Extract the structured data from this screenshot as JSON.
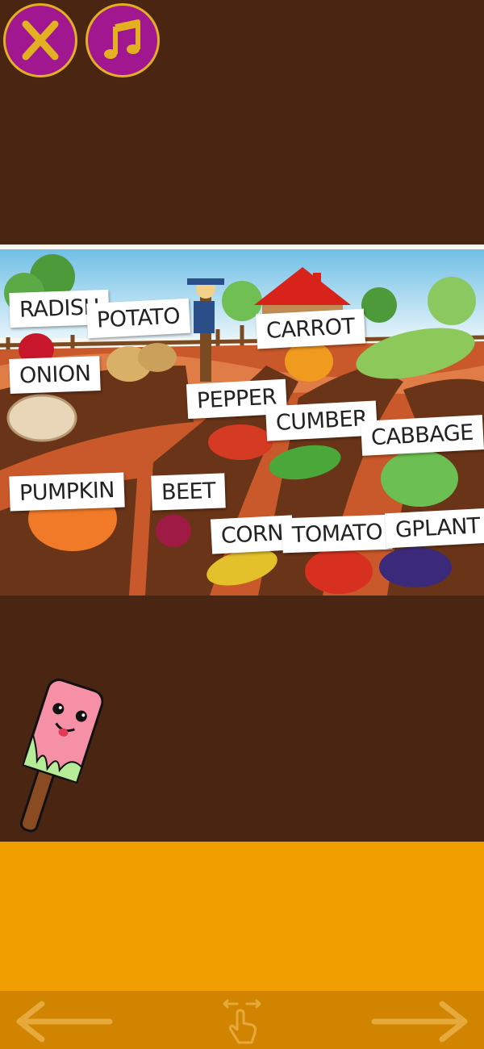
{
  "toolbar": {
    "close_icon": "close-x-icon",
    "music_icon": "music-note-icon"
  },
  "scene": {
    "labels": {
      "radish": "RADISH",
      "potato": "POTATO",
      "carrot": "CARROT",
      "onion": "ONION",
      "pepper": "PEPPER",
      "cucumber": "CUMBER",
      "cabbage": "CABBAGE",
      "pumpkin": "PUMPKIN",
      "beet": "BEET",
      "corn": "CORN",
      "tomato": "TOMATO",
      "eggplant": "GPLANT"
    }
  },
  "colors": {
    "background": "#4a2512",
    "button_fill": "#a0178f",
    "button_border": "#e2b021",
    "panel": "#f19f00",
    "bottom_bar": "#d18400"
  },
  "navigation": {
    "prev_icon": "arrow-left-icon",
    "gesture_icon": "swipe-hand-icon",
    "next_icon": "arrow-right-icon"
  }
}
